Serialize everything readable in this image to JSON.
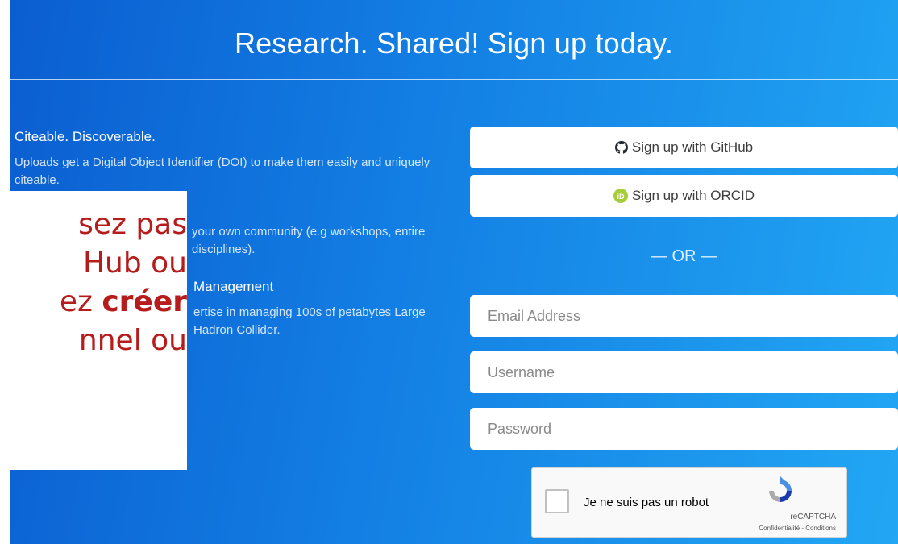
{
  "hero": {
    "title": "Research. Shared! Sign up today."
  },
  "features": [
    {
      "title": "Citeable. Discoverable.",
      "text": "Uploads get a Digital Object Identifier (DOI) to make them easily and uniquely citeable."
    },
    {
      "title": "",
      "text": "your own community (e.g workshops, entire disciplines)."
    },
    {
      "title": "Management",
      "text": "ertise in managing 100s of petabytes Large Hadron Collider."
    }
  ],
  "auth": {
    "github_label": "Sign up with GitHub",
    "orcid_label": "Sign up with ORCID",
    "or_label": "— OR —",
    "email_placeholder": "Email Address",
    "username_placeholder": "Username",
    "password_placeholder": "Password"
  },
  "captcha": {
    "label": "Je ne suis pas un robot",
    "brand": "reCAPTCHA",
    "links": "Confidentialité - Conditions"
  },
  "overlay": {
    "line1": "sez pas",
    "line2": "Hub ou",
    "line3_start": "ez ",
    "line3_bold": "créer",
    "line4": "nnel ou"
  },
  "colors": {
    "accent_red": "#b71c1c",
    "gradient_start": "#0b5ed0",
    "gradient_end": "#22a7f4",
    "orcid_green": "#a6ce39"
  }
}
